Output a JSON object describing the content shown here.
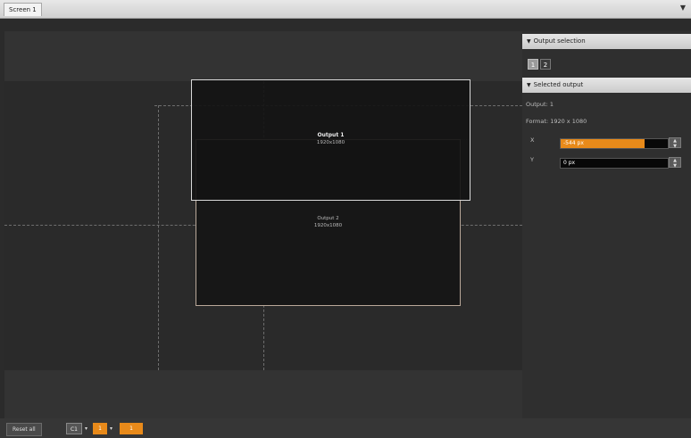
{
  "window": {
    "tab_title": "Screen 1",
    "menu_icon": "triangle-down-icon"
  },
  "canvas": {
    "outputs": [
      {
        "name": "Output 1",
        "resolution": "1920x1080"
      },
      {
        "name": "Output 2",
        "resolution": "1920x1080"
      }
    ]
  },
  "panel": {
    "output_selection": {
      "header": "Output selection",
      "buttons": [
        "1",
        "2"
      ],
      "selected": "1"
    },
    "selected_output": {
      "header": "Selected output",
      "output_label": "Output:",
      "output_value": "1",
      "format_label": "Format:",
      "format_value": "1920 x 1080",
      "x_label": "X",
      "x_value": "-544 px",
      "x_level": 0.78,
      "y_label": "Y",
      "y_value": "0 px",
      "y_level": 0.0
    }
  },
  "bottombar": {
    "reset_label": "Reset all",
    "selectors": [
      "C1",
      "1",
      "1"
    ]
  },
  "colors": {
    "accent": "#e88a1a",
    "selected_button": "#9a9a9a"
  }
}
